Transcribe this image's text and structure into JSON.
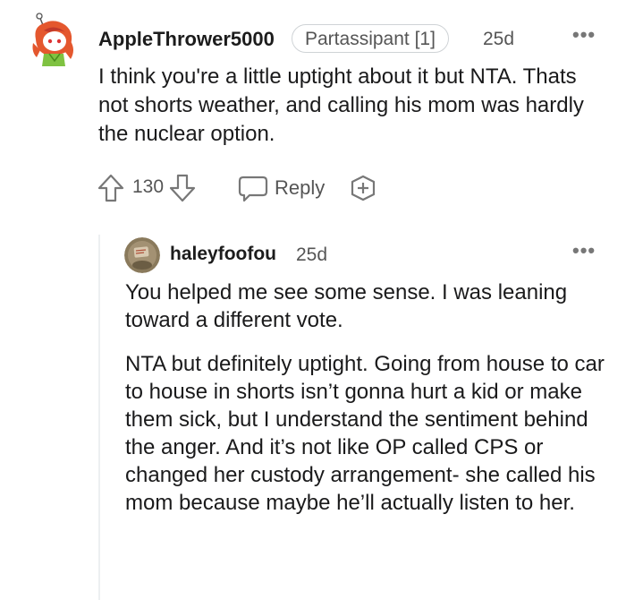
{
  "comment": {
    "username": "AppleThrower5000",
    "flair": "Partassipant [1]",
    "age": "25d",
    "more": "•••",
    "body": "I think you're a little uptight about it but NTA. Thats not shorts weather, and calling his mom was hardly the nuclear option.",
    "score": "130",
    "reply_label": "Reply"
  },
  "reply": {
    "username": "haleyfoofou",
    "age": "25d",
    "more": "•••",
    "paragraphs": [
      "You helped me see some sense. I was leaning toward a different vote.",
      "NTA but definitely uptight. Going from house to car to house in shorts isn’t gonna hurt a kid or make them sick, but I understand the sentiment behind the anger. And it’s not like OP called CPS or changed her custody arrangement- she called his mom because maybe he’ll actually listen to her."
    ]
  },
  "icons": [
    "snoo-avatar-icon",
    "user-avatar-icon",
    "upvote-icon",
    "downvote-icon",
    "reply-icon",
    "award-icon",
    "more-options-icon"
  ]
}
